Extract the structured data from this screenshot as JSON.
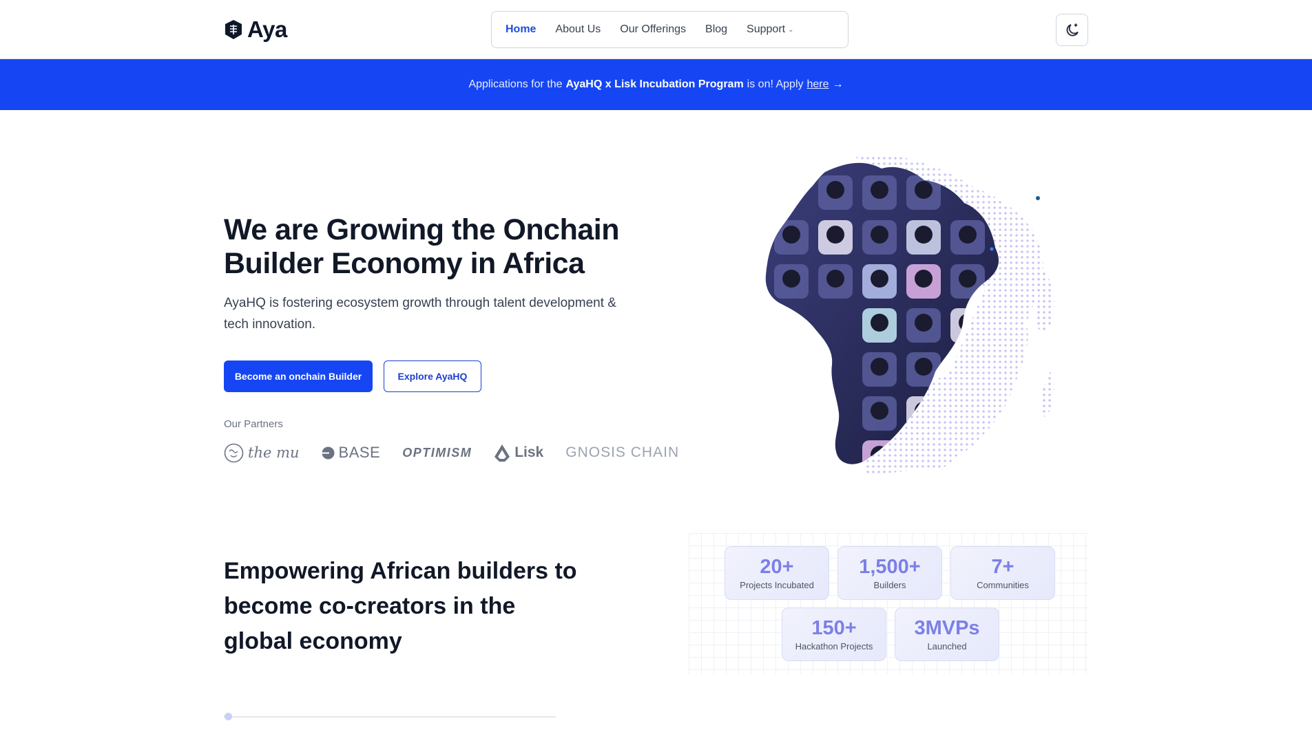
{
  "header": {
    "logo_text": "Aya",
    "nav": [
      {
        "label": "Home",
        "active": true
      },
      {
        "label": "About Us"
      },
      {
        "label": "Our Offerings"
      },
      {
        "label": "Blog"
      },
      {
        "label": "Support",
        "dropdown": true
      }
    ],
    "theme_toggle_icon": "moon-icon"
  },
  "banner": {
    "prefix": "Applications for the",
    "program": "AyaHQ x Lisk Incubation Program",
    "middle": "is on! Apply",
    "link": "here",
    "arrow": "→"
  },
  "hero": {
    "title": "We are Growing the Onchain Builder Economy in Africa",
    "subtitle": "AyaHQ is fostering ecosystem growth through talent development & tech innovation.",
    "primary_cta": "Become an onchain Builder",
    "secondary_cta": "Explore AyaHQ",
    "partners_label": "Our Partners",
    "partners": [
      "the mu",
      "BASE",
      "OPTIMISM",
      "Lisk",
      "GNOSIS CHAIN"
    ]
  },
  "section2": {
    "title": "Empowering African builders to become co-creators in the global economy"
  },
  "stats": [
    {
      "value": "20+",
      "label": "Projects Incubated"
    },
    {
      "value": "1,500+",
      "label": "Builders"
    },
    {
      "value": "7+",
      "label": "Communities"
    },
    {
      "value": "150+",
      "label": "Hackathon Projects"
    },
    {
      "value": "3MVPs",
      "label": "Launched"
    }
  ],
  "colors": {
    "brand_blue": "#1646f3",
    "stat_value": "#7c7fe6",
    "text_dark": "#111827"
  }
}
